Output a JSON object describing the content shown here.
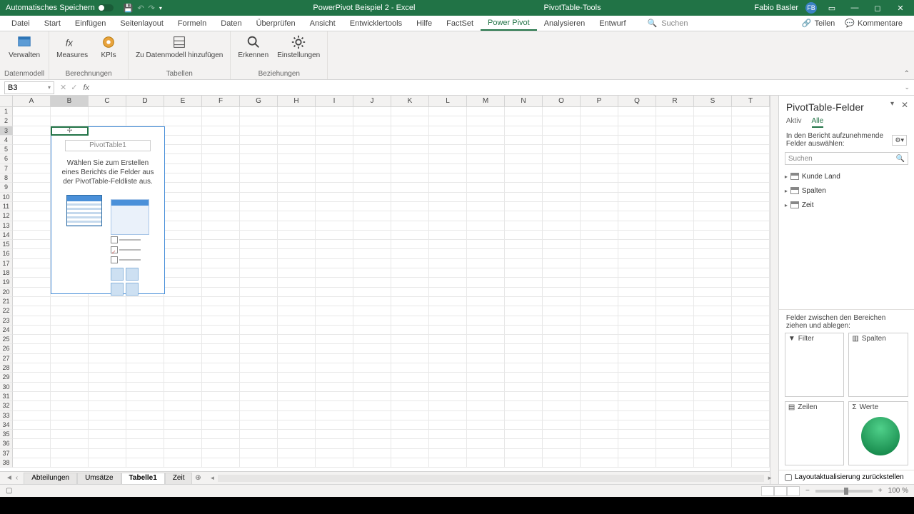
{
  "titlebar": {
    "autosave": "Automatisches Speichern",
    "doc_title": "PowerPivot Beispiel 2 - Excel",
    "tools_title": "PivotTable-Tools",
    "user": "Fabio Basler",
    "user_initials": "FB"
  },
  "tabs": [
    "Datei",
    "Start",
    "Einfügen",
    "Seitenlayout",
    "Formeln",
    "Daten",
    "Überprüfen",
    "Ansicht",
    "Entwicklertools",
    "Hilfe",
    "FactSet",
    "Power Pivot",
    "Analysieren",
    "Entwurf"
  ],
  "active_tab": "Power Pivot",
  "search_placeholder": "Suchen",
  "share": "Teilen",
  "comments": "Kommentare",
  "ribbon": {
    "groups": [
      {
        "label": "Datenmodell",
        "buttons": [
          {
            "label": "Verwalten"
          }
        ]
      },
      {
        "label": "Berechnungen",
        "buttons": [
          {
            "label": "Measures"
          },
          {
            "label": "KPIs"
          }
        ]
      },
      {
        "label": "Tabellen",
        "buttons": [
          {
            "label": "Zu Datenmodell hinzufügen"
          }
        ]
      },
      {
        "label": "Beziehungen",
        "buttons": [
          {
            "label": "Erkennen"
          },
          {
            "label": "Einstellungen"
          }
        ]
      }
    ]
  },
  "name_box": "B3",
  "columns": [
    "A",
    "B",
    "C",
    "D",
    "E",
    "F",
    "G",
    "H",
    "I",
    "J",
    "K",
    "L",
    "M",
    "N",
    "O",
    "P",
    "Q",
    "R",
    "S",
    "T"
  ],
  "pivot_placeholder": {
    "title": "PivotTable1",
    "text": "Wählen Sie zum Erstellen eines Berichts die Felder aus der PivotTable-Feldliste aus."
  },
  "field_pane": {
    "title": "PivotTable-Felder",
    "tabs": [
      "Aktiv",
      "Alle"
    ],
    "active_tab": "Alle",
    "subtitle": "In den Bericht aufzunehmende Felder auswählen:",
    "search": "Suchen",
    "tables": [
      "Kunde Land",
      "Spalten",
      "Zeit"
    ],
    "areas_label": "Felder zwischen den Bereichen ziehen und ablegen:",
    "areas": {
      "filter": "Filter",
      "columns": "Spalten",
      "rows": "Zeilen",
      "values": "Werte"
    },
    "defer": "Layoutaktualisierung zurückstellen"
  },
  "sheet_tabs": [
    "Abteilungen",
    "Umsätze",
    "Tabelle1",
    "Zeit"
  ],
  "active_sheet": "Tabelle1",
  "zoom": "100 %"
}
